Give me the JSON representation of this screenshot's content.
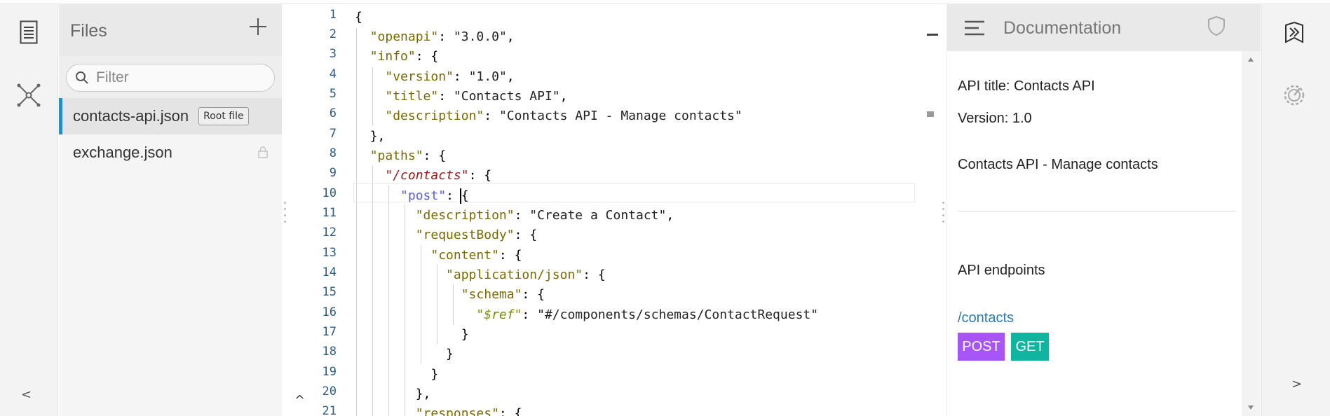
{
  "left_bar": {
    "icons": [
      "document-icon",
      "network-icon"
    ],
    "collapse_label": "<"
  },
  "files": {
    "title": "Files",
    "filter_placeholder": "Filter",
    "items": [
      {
        "name": "contacts-api.json",
        "badge": "Root file",
        "active": true
      },
      {
        "name": "exchange.json",
        "locked": true
      }
    ]
  },
  "editor": {
    "line_numbers": [
      "1",
      "2",
      "3",
      "4",
      "5",
      "6",
      "7",
      "8",
      "9",
      "10",
      "11",
      "12",
      "13",
      "14",
      "15",
      "16",
      "17",
      "18",
      "19",
      "20",
      "21"
    ],
    "scroll_up_label": "^"
  },
  "documentation": {
    "title": "Documentation",
    "api_title": "API title: Contacts API",
    "version": "Version: 1.0",
    "description": "Contacts API - Manage contacts",
    "endpoints_heading": "API endpoints",
    "endpoint_path": "/contacts",
    "methods": [
      {
        "label": "POST",
        "color": "#a855f7"
      },
      {
        "label": "GET",
        "color": "#10b5a0"
      }
    ]
  },
  "right_bar": {
    "icons": [
      "bookmark-icon",
      "settings-gauge-icon"
    ],
    "expand_label": ">"
  }
}
